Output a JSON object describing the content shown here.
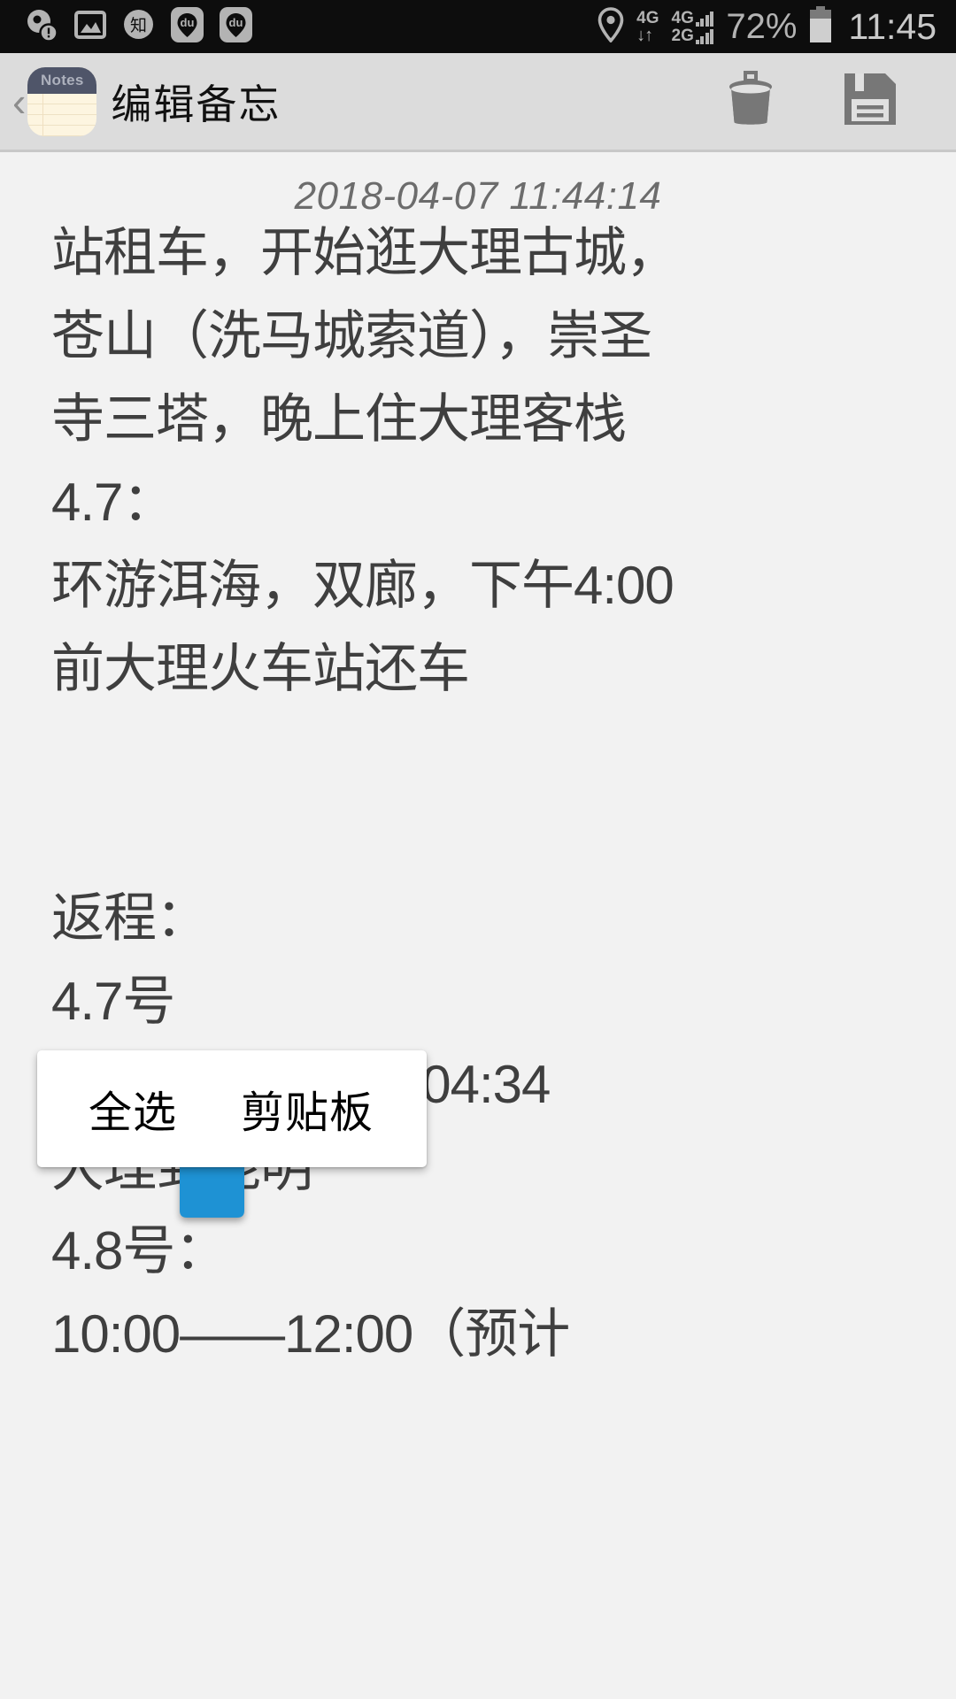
{
  "status_bar": {
    "background": "#0d0d0d",
    "foreground": "#b3b3b3",
    "left_icons": [
      {
        "name": "media-error-icon",
        "glyph": "disc-alert"
      },
      {
        "name": "gallery-image-icon",
        "glyph": "picture"
      },
      {
        "name": "zhihu-app-icon",
        "glyph": "知"
      },
      {
        "name": "baidu-map-icon",
        "glyph": "du"
      },
      {
        "name": "baidu-app-icon",
        "glyph": "du"
      }
    ],
    "location_icon": "location-pin-icon",
    "sim1_network": "4G",
    "sim1_data": "↓↑",
    "sim2_network_top": "4G",
    "sim2_network_bottom": "2G",
    "battery_percent": "72%",
    "clock": "11:45"
  },
  "action_bar": {
    "background": "#dcdcdc",
    "back_label": "‹",
    "app_icon_label": "Notes",
    "title": "编辑备忘",
    "delete_label": "delete-icon",
    "save_label": "save-icon"
  },
  "note": {
    "timestamp": "2018-04-07 11:44:14",
    "lines": [
      "站租车，开始逛大理古城，",
      "苍山（洗马城索道），崇圣",
      "寺三塔，晚上住大理客栈",
      "4.7：",
      "环游洱海，双廊，下午4:00",
      "前大理火车站还车",
      "",
      "",
      "返程：",
      "4.7号",
      "21:34一一4.8 号04:34",
      "大理到昆明",
      "4.8号：",
      "10:00——12:00（预计"
    ],
    "text_color": "#3f3f3f"
  },
  "popup_menu": {
    "items": [
      {
        "name": "select-all",
        "label": "全选"
      },
      {
        "name": "clipboard",
        "label": "剪贴板"
      }
    ],
    "background": "#ffffff"
  },
  "cursor_handle": {
    "name": "text-cursor-handle",
    "color_top": "#4fc3f0",
    "color_body": "#1e92d4"
  }
}
